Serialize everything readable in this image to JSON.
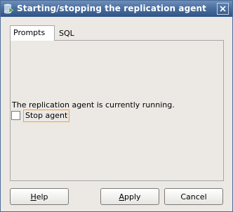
{
  "window": {
    "title": "Starting/stopping the replication agent"
  },
  "tabs": [
    {
      "label": "Prompts",
      "active": true
    },
    {
      "label": "SQL",
      "active": false
    }
  ],
  "panel": {
    "status_text": "The replication agent is currently running.",
    "stop_agent": {
      "label": "Stop agent",
      "checked": false
    }
  },
  "buttons": {
    "help": {
      "mnemonic": "H",
      "rest": "elp"
    },
    "apply": {
      "mnemonic": "A",
      "rest": "pply"
    },
    "cancel": {
      "label": "Cancel"
    }
  },
  "colors": {
    "titlebar": "#3d6394",
    "focus_border": "#e7a64a",
    "dialog_bg": "#ece9e4"
  },
  "icons": {
    "title": "database-agent-icon",
    "close": "close-icon"
  }
}
